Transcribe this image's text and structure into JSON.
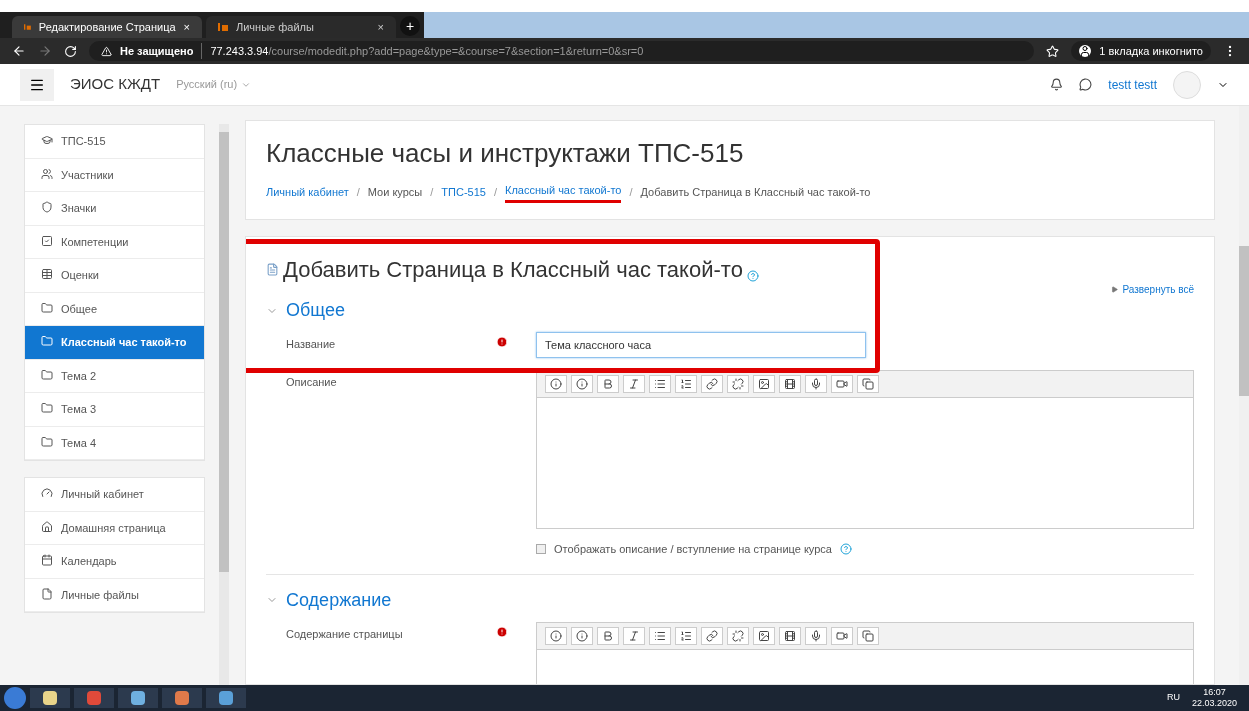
{
  "browser": {
    "tabs": [
      {
        "title": "Редактирование Страница",
        "close": "×",
        "selected": true
      },
      {
        "title": "Личные файлы",
        "close": "×",
        "selected": false
      }
    ],
    "new_tab": "+",
    "security": "Не защищено",
    "url_host": "77.243.3.94",
    "url_path": "/course/modedit.php?add=page&type=&course=7&section=1&return=0&sr=0",
    "incognito": "1 вкладка инкогнито"
  },
  "navbar": {
    "brand": "ЭИОС КЖДТ",
    "language": "Русский (ru)",
    "user": "testt testt"
  },
  "sidebar": {
    "groups": [
      [
        {
          "label": "ТПС-515",
          "kind": "course",
          "selected": false
        },
        {
          "label": "Участники",
          "kind": "participants",
          "selected": false
        },
        {
          "label": "Значки",
          "kind": "badges",
          "selected": false
        },
        {
          "label": "Компетенции",
          "kind": "competencies",
          "selected": false
        },
        {
          "label": "Оценки",
          "kind": "grades",
          "selected": false
        },
        {
          "label": "Общее",
          "kind": "section",
          "selected": false
        },
        {
          "label": "Классный час такой-то",
          "kind": "section",
          "selected": true
        },
        {
          "label": "Тема 2",
          "kind": "section",
          "selected": false
        },
        {
          "label": "Тема 3",
          "kind": "section",
          "selected": false
        },
        {
          "label": "Тема 4",
          "kind": "section",
          "selected": false
        }
      ],
      [
        {
          "label": "Личный кабинет",
          "kind": "dashboard",
          "selected": false
        },
        {
          "label": "Домашняя страница",
          "kind": "home",
          "selected": false
        },
        {
          "label": "Календарь",
          "kind": "calendar",
          "selected": false
        },
        {
          "label": "Личные файлы",
          "kind": "files",
          "selected": false
        }
      ]
    ]
  },
  "page_header": {
    "title": "Классные часы и инструктажи ТПС-515",
    "separator": "/",
    "breadcrumb": [
      {
        "label": "Личный кабинет",
        "link": true,
        "underlined": false
      },
      {
        "label": "Мои курсы",
        "link": false,
        "underlined": false
      },
      {
        "label": "ТПС-515",
        "link": true,
        "underlined": false
      },
      {
        "label": "Классный час такой-то",
        "link": true,
        "underlined": true
      },
      {
        "label": "Добавить Страница в Классный час такой-то",
        "link": false,
        "underlined": false
      }
    ]
  },
  "form": {
    "heading": "Добавить Страница в Классный час такой-то",
    "expand_all": "Развернуть всё",
    "sections": [
      {
        "title": "Общее",
        "expanded": true,
        "fields": [
          {
            "label": "Название",
            "required": true,
            "kind": "text",
            "value": "Тема классного часа",
            "highlighted": true
          },
          {
            "label": "Описание",
            "required": false,
            "kind": "editor"
          }
        ],
        "checkbox": {
          "label": "Отображать описание / вступление на странице курса",
          "checked": false
        }
      },
      {
        "title": "Содержание",
        "expanded": true,
        "fields": [
          {
            "label": "Содержание страницы",
            "required": true,
            "kind": "editor"
          }
        ]
      }
    ]
  },
  "taskbar": {
    "language": "RU",
    "time": "16:07",
    "date": "22.03.2020"
  }
}
